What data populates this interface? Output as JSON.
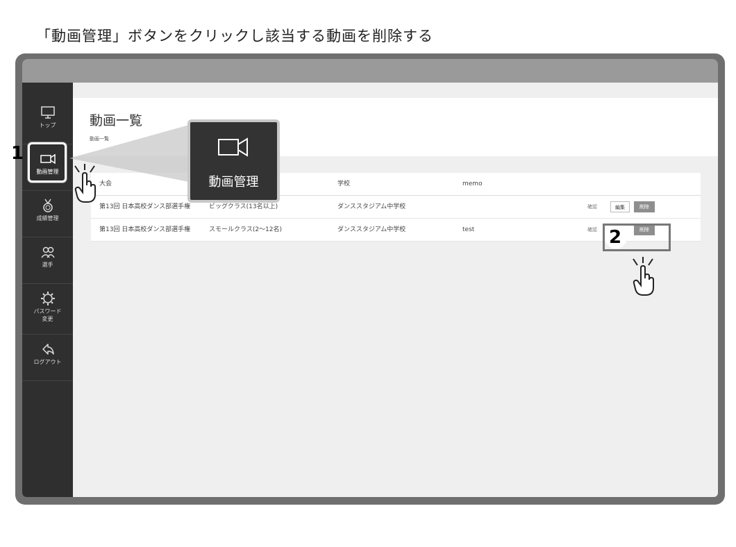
{
  "instruction": "「動画管理」ボタンをクリックし該当する動画を削除する",
  "sidebar": {
    "items": [
      {
        "icon": "monitor-icon",
        "label": "トップ"
      },
      {
        "icon": "video-camera-icon",
        "label": "動画管理"
      },
      {
        "icon": "medal-icon",
        "label": "成績管理"
      },
      {
        "icon": "users-icon",
        "label": "選手"
      },
      {
        "icon": "gear-icon",
        "label_line1": "パスワード",
        "label_line2": "変更"
      },
      {
        "icon": "logout-arrow-icon",
        "label": "ログアウト"
      }
    ]
  },
  "main": {
    "title": "動画一覧",
    "breadcrumb": "動画一覧"
  },
  "table": {
    "headers": [
      "大会",
      "",
      "学校",
      "memo"
    ],
    "rows": [
      {
        "tournament": "第13回 日本高校ダンス部選手権",
        "class": "ビッグクラス(13名以上)",
        "school": "ダンススタジアム中学校",
        "memo": "",
        "confirm": "確認",
        "edit": "編集",
        "delete": "削除"
      },
      {
        "tournament": "第13回 日本高校ダンス部選手権",
        "class": "スモールクラス(2〜12名)",
        "school": "ダンススタジアム中学校",
        "memo": "test",
        "confirm": "確認",
        "delete": "削除"
      }
    ]
  },
  "callout": {
    "icon": "video-camera-icon",
    "label": "動画管理"
  },
  "steps": {
    "one": "1",
    "two": "2"
  },
  "colors": {
    "sidebar": "#2f2f2f",
    "frame": "#6f6f6f",
    "delete_button": "#8e8e8e"
  }
}
